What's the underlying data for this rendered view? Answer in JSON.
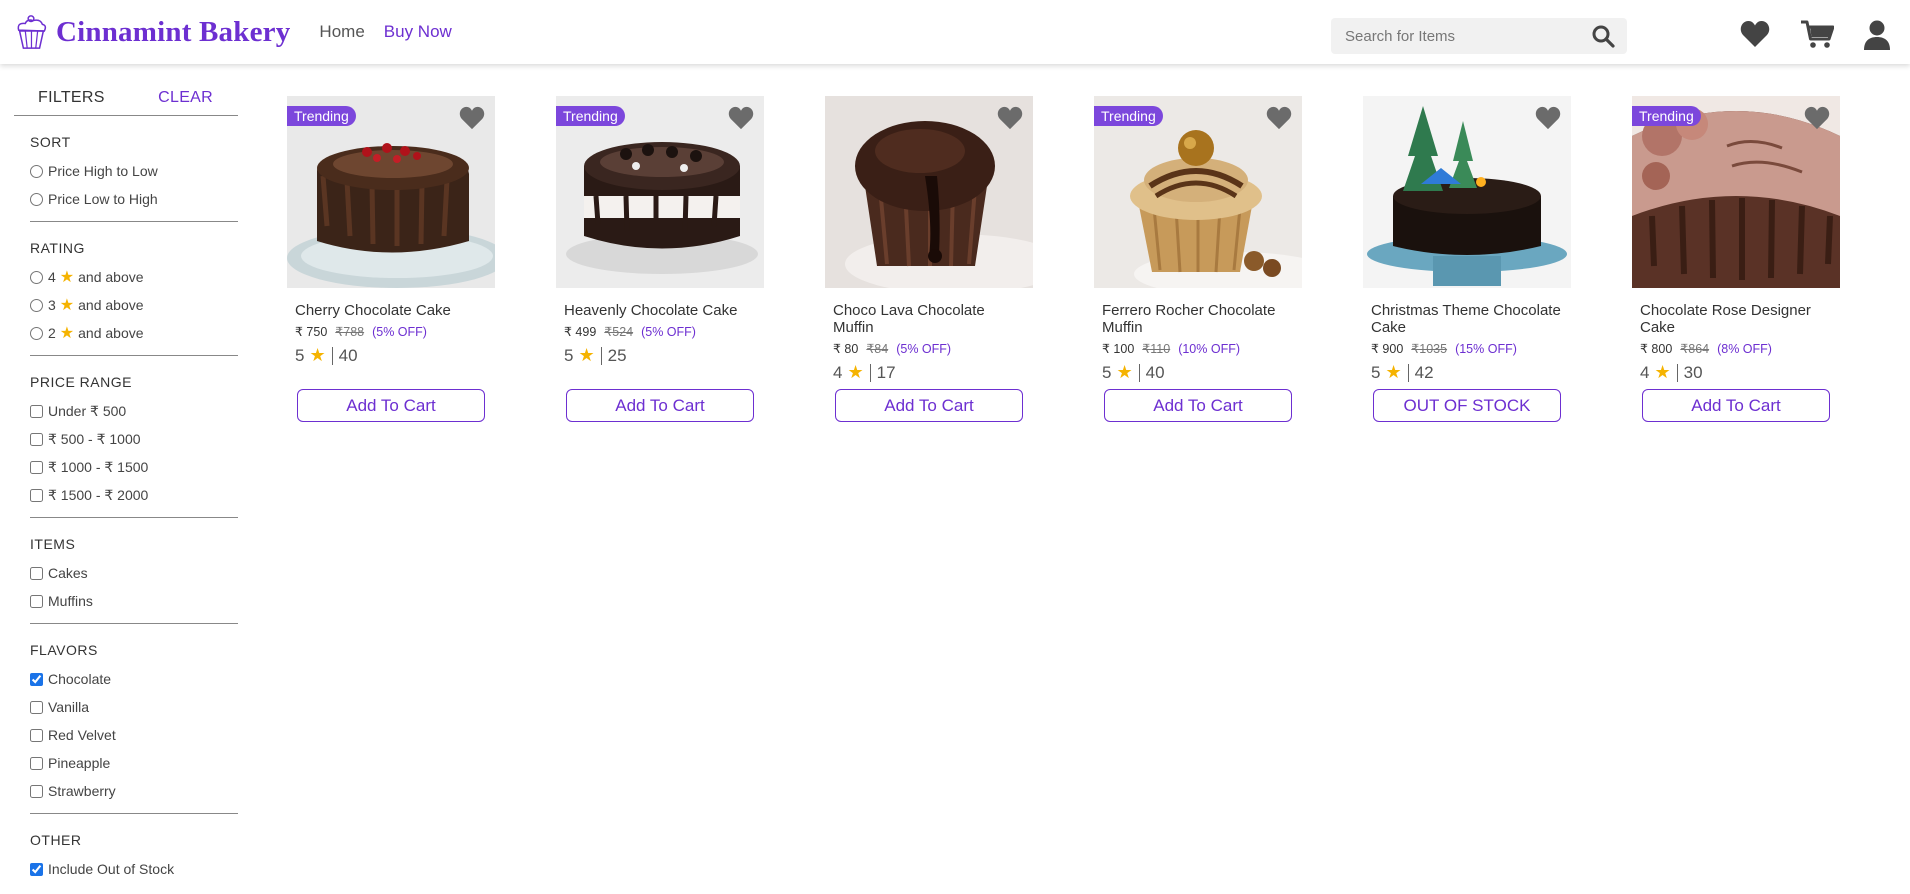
{
  "header": {
    "brand": "Cinnamint Bakery",
    "nav": [
      {
        "label": "Home",
        "active": false
      },
      {
        "label": "Buy Now",
        "active": true
      }
    ],
    "search_placeholder": "Search for Items",
    "icons": [
      "search-icon",
      "heart-icon",
      "cart-icon",
      "user-icon"
    ]
  },
  "filters": {
    "title": "FILTERS",
    "clear_label": "CLEAR",
    "sort": {
      "title": "SORT",
      "options": [
        "Price High to Low",
        "Price Low to High"
      ]
    },
    "rating": {
      "title": "RATING",
      "options": [
        {
          "value": "4",
          "suffix": "and above"
        },
        {
          "value": "3",
          "suffix": "and above"
        },
        {
          "value": "2",
          "suffix": "and above"
        }
      ]
    },
    "price_range": {
      "title": "PRICE RANGE",
      "options": [
        "Under ₹ 500",
        "₹ 500 - ₹ 1000",
        "₹ 1000 - ₹ 1500",
        "₹ 1500 - ₹ 2000"
      ]
    },
    "items": {
      "title": "ITEMS",
      "options": [
        "Cakes",
        "Muffins"
      ]
    },
    "flavors": {
      "title": "FLAVORS",
      "options": [
        {
          "label": "Chocolate",
          "checked": true
        },
        {
          "label": "Vanilla",
          "checked": false
        },
        {
          "label": "Red Velvet",
          "checked": false
        },
        {
          "label": "Pineapple",
          "checked": false
        },
        {
          "label": "Strawberry",
          "checked": false
        }
      ]
    },
    "other": {
      "title": "OTHER",
      "options": [
        {
          "label": "Include Out of Stock",
          "checked": true
        }
      ]
    }
  },
  "products": [
    {
      "name": "Cherry Chocolate Cake",
      "trending": true,
      "badge": "Trending",
      "price": "₹ 750",
      "old_price": "₹788",
      "discount": "(5% OFF)",
      "rating": "5",
      "reviews": "40",
      "button": "Add To Cart"
    },
    {
      "name": "Heavenly Chocolate Cake",
      "trending": true,
      "badge": "Trending",
      "price": "₹ 499",
      "old_price": "₹524",
      "discount": "(5% OFF)",
      "rating": "5",
      "reviews": "25",
      "button": "Add To Cart"
    },
    {
      "name": "Choco Lava Chocolate Muffin",
      "trending": false,
      "badge": "",
      "price": "₹ 80",
      "old_price": "₹84",
      "discount": "(5% OFF)",
      "rating": "4",
      "reviews": "17",
      "button": "Add To Cart"
    },
    {
      "name": "Ferrero Rocher Chocolate Muffin",
      "trending": true,
      "badge": "Trending",
      "price": "₹ 100",
      "old_price": "₹110",
      "discount": "(10% OFF)",
      "rating": "5",
      "reviews": "40",
      "button": "Add To Cart"
    },
    {
      "name": "Christmas Theme Chocolate Cake",
      "trending": false,
      "badge": "",
      "price": "₹ 900",
      "old_price": "₹1035",
      "discount": "(15% OFF)",
      "rating": "5",
      "reviews": "42",
      "button": "OUT OF STOCK"
    },
    {
      "name": "Chocolate Rose Designer Cake",
      "trending": true,
      "badge": "Trending",
      "price": "₹ 800",
      "old_price": "₹864",
      "discount": "(8% OFF)",
      "rating": "4",
      "reviews": "30",
      "button": "Add To Cart"
    }
  ],
  "colors": {
    "accent": "#6d2fd1",
    "badge": "#7c47dc",
    "star": "#f5b301"
  }
}
